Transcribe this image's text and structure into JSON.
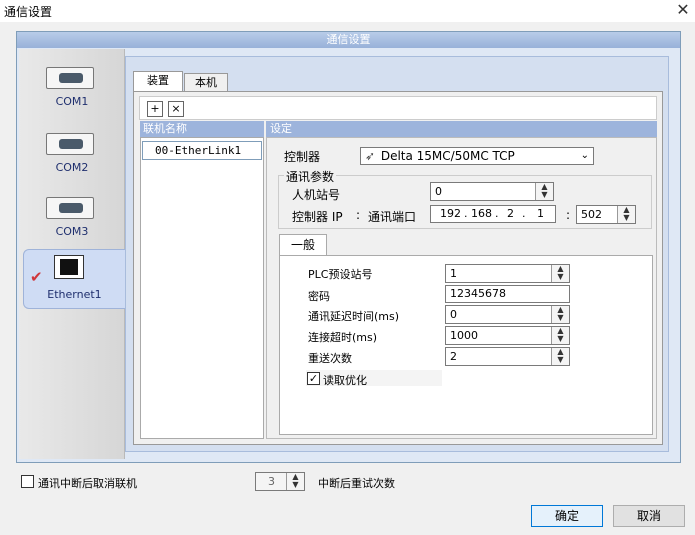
{
  "window": {
    "title": "通信设置",
    "close_glyph": "✕"
  },
  "panel": {
    "title": "通信设置"
  },
  "devices": [
    {
      "label": "COM1",
      "icon": "serial-port-icon"
    },
    {
      "label": "COM2",
      "icon": "serial-port-icon"
    },
    {
      "label": "COM3",
      "icon": "serial-port-icon"
    },
    {
      "label": "Ethernet1",
      "icon": "ethernet-port-icon",
      "selected": true
    }
  ],
  "tabs": [
    {
      "label": "装置"
    },
    {
      "label": "本机"
    }
  ],
  "toolbar": {
    "add_glyph": "+",
    "delete_glyph": "×"
  },
  "list": {
    "header": "联机名称",
    "items": [
      "00-EtherLink1"
    ]
  },
  "settings": {
    "header": "设定",
    "controller_label": "控制器",
    "controller_value": "Delta 15MC/50MC TCP",
    "comm_params_label": "通讯参数",
    "hmi_station_label": "人机站号",
    "hmi_station_value": "0",
    "controller_ip_label": "控制器 IP",
    "colon": ":",
    "comm_port_label": "通讯端口",
    "ip": [
      "192",
      "168",
      "2",
      "1"
    ],
    "port_value": "502"
  },
  "general_tab": {
    "label": "一般",
    "fields": [
      {
        "label": "PLC预设站号",
        "value": "1",
        "type": "spin"
      },
      {
        "label": "密码",
        "value": "12345678",
        "type": "input"
      },
      {
        "label": "通讯延迟时间(ms)",
        "value": "0",
        "type": "spin"
      },
      {
        "label": "连接超时(ms)",
        "value": "1000",
        "type": "spin"
      },
      {
        "label": "重送次数",
        "value": "2",
        "type": "spin"
      }
    ],
    "read_optimize_label": "读取优化",
    "read_optimize_checked": true
  },
  "footer": {
    "disconnect_label": "通讯中断后取消联机",
    "retry_count": "3",
    "retry_label": "中断后重试次数",
    "ok_label": "确定",
    "cancel_label": "取消"
  },
  "colors": {
    "accent": "#9db4dc",
    "selection": "#cfdcf4",
    "check": "#d0363b"
  }
}
